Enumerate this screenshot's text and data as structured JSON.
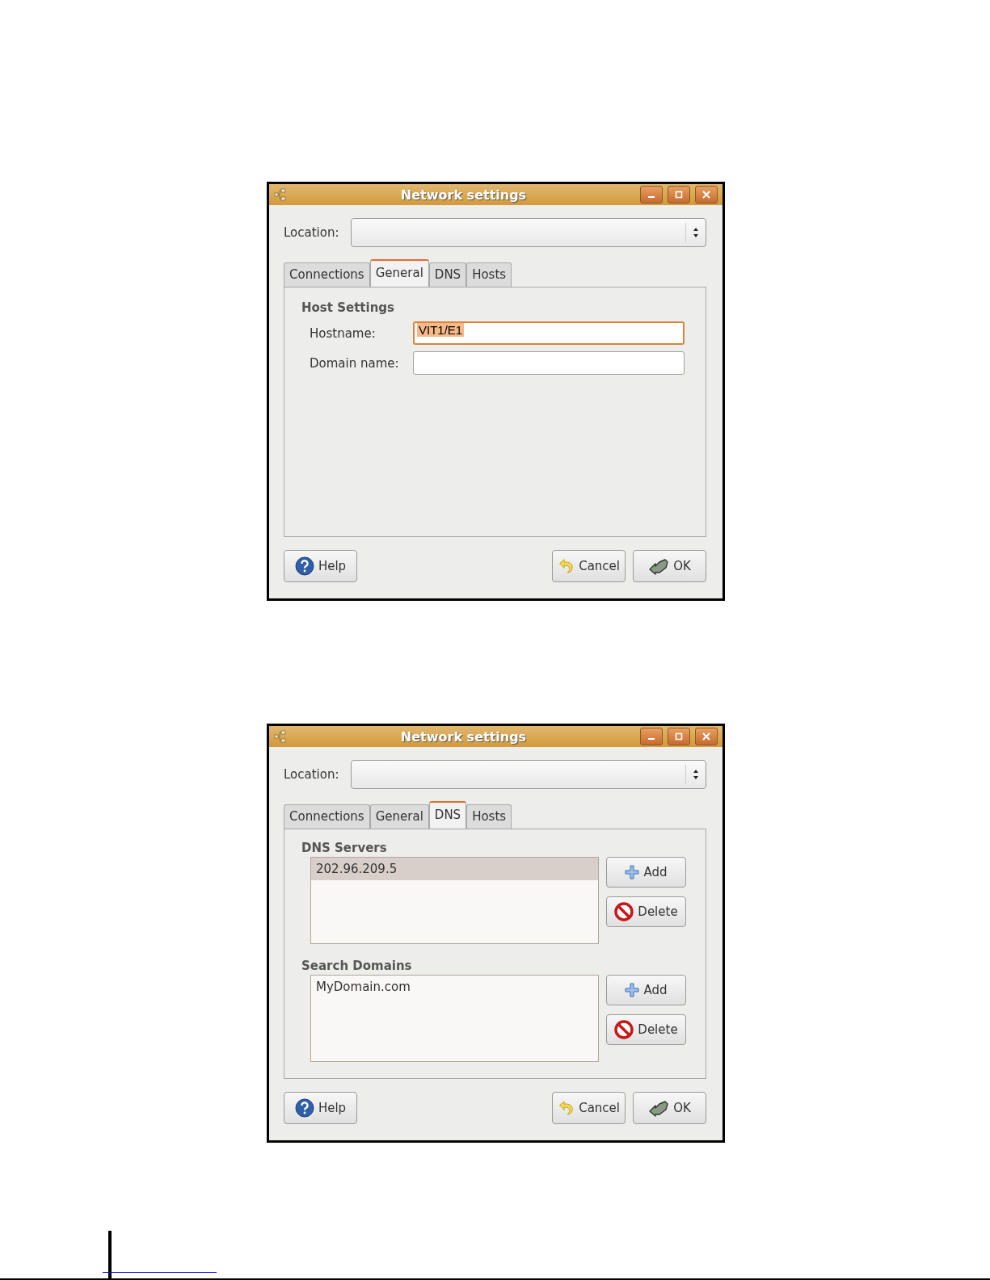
{
  "dialogs": [
    {
      "title": "Network settings",
      "location": {
        "label": "Location:"
      },
      "tabs": [
        {
          "label": "Connections",
          "selected": false
        },
        {
          "label": "General",
          "selected": true
        },
        {
          "label": "DNS",
          "selected": false
        },
        {
          "label": "Hosts",
          "selected": false
        }
      ],
      "page": {
        "kind": "general",
        "heading": "Host Settings",
        "fields": [
          {
            "label": "Hostname:",
            "value": "VIT1/E1",
            "focused": true,
            "value_selected": true
          },
          {
            "label": "Domain name:",
            "focused": false
          }
        ]
      },
      "buttons": [
        {
          "label": "Help",
          "kind": "help"
        },
        {
          "label": "Cancel",
          "kind": "cancel"
        },
        {
          "label": "OK",
          "kind": "ok"
        }
      ]
    },
    {
      "title": "Network settings",
      "location": {
        "label": "Location:"
      },
      "tabs": [
        {
          "label": "Connections",
          "selected": false
        },
        {
          "label": "General",
          "selected": false
        },
        {
          "label": "DNS",
          "selected": true
        },
        {
          "label": "Hosts",
          "selected": false
        }
      ],
      "page": {
        "kind": "dns",
        "sections": [
          {
            "heading": "DNS Servers",
            "items": [
              {
                "text": "202.96.209.5",
                "selected": true
              }
            ],
            "buttons": [
              {
                "label": "Add",
                "kind": "add"
              },
              {
                "label": "Delete",
                "kind": "delete"
              }
            ]
          },
          {
            "heading": "Search Domains",
            "items": [
              {
                "text": "MyDomain.com",
                "selected": false
              }
            ],
            "buttons": [
              {
                "label": "Add",
                "kind": "add"
              },
              {
                "label": "Delete",
                "kind": "delete"
              }
            ]
          }
        ]
      },
      "buttons": [
        {
          "label": "Help",
          "kind": "help"
        },
        {
          "label": "Cancel",
          "kind": "cancel"
        },
        {
          "label": "OK",
          "kind": "ok"
        }
      ]
    }
  ]
}
